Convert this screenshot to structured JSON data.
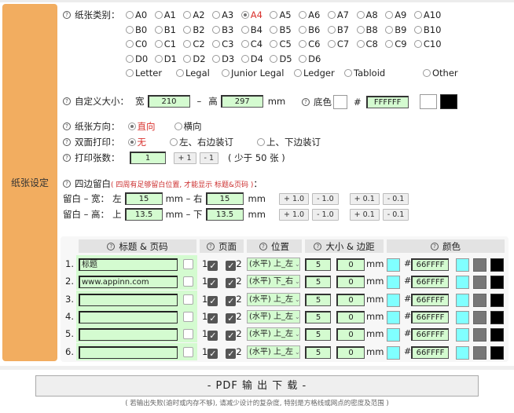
{
  "section": {
    "label": "纸张设定"
  },
  "paper_type": {
    "label": "纸张类别：",
    "selected": "A4",
    "rows": [
      [
        "A0",
        "A1",
        "A2",
        "A3",
        "A4",
        "A5",
        "A6",
        "A7",
        "A8",
        "A9",
        "A10"
      ],
      [
        "B0",
        "B1",
        "B2",
        "B3",
        "B4",
        "B5",
        "B6",
        "B7",
        "B8",
        "B9",
        "B10"
      ],
      [
        "C0",
        "C1",
        "C2",
        "C3",
        "C4",
        "C5",
        "C6",
        "C7",
        "C8",
        "C9",
        "C10"
      ],
      [
        "D0",
        "D1",
        "D2",
        "D3",
        "D4",
        "D5",
        "D6"
      ]
    ],
    "extra": [
      "Letter",
      "Legal",
      "Junior Legal",
      "Ledger",
      "Tabloid",
      "Other"
    ]
  },
  "custom_size": {
    "label": "自定义大小：",
    "width_label": "宽",
    "width": "210",
    "dash": "–",
    "height_label": "高",
    "height": "297",
    "unit": "mm"
  },
  "bg_color": {
    "label": "底色",
    "hash": "#",
    "value": "FFFFFF",
    "swatches": [
      "#FFFFFF",
      "#000000"
    ]
  },
  "orientation": {
    "label": "纸张方向：",
    "options": [
      "直向",
      "横向"
    ],
    "selected": "直向"
  },
  "duplex": {
    "label": "双面打印：",
    "options": [
      "无",
      "左、右边装订",
      "上、下边装订"
    ],
    "selected": "无"
  },
  "copies": {
    "label": "打印张数：",
    "value": "1",
    "plus": "+ 1",
    "minus": "- 1",
    "note": "( 少于 50 张 )"
  },
  "margins": {
    "label": "四边留白",
    "note": "( 四周有足够留白位置, 才能显示 标题&页码 )",
    "colon": "：",
    "width_row": {
      "label": "留白 – 宽：",
      "a_label": "左",
      "a": "15",
      "mid": "mm – 右",
      "b": "15",
      "unit": "mm"
    },
    "height_row": {
      "label": "留白 – 高：",
      "a_label": "上",
      "a": "13.5",
      "mid": "mm – 下",
      "b": "13.5",
      "unit": "mm"
    },
    "buttons": [
      "+ 1.0",
      "- 1.0",
      "+ 0.1",
      "- 0.1"
    ]
  },
  "header_table": {
    "columns": [
      "标题 & 页码",
      "页面",
      "位置",
      "大小 & 边距",
      "颜色"
    ],
    "rows": [
      {
        "num": "1.",
        "text": "标题",
        "page1": "1",
        "page2": "2",
        "position": "(水平) 上_左",
        "size": "5",
        "margin": "0",
        "unit": "mm",
        "hash": "#",
        "color": "66FFFF"
      },
      {
        "num": "2.",
        "text": "www.appinn.com",
        "page1": "1",
        "page2": "2",
        "position": "(水平) 下_右",
        "size": "5",
        "margin": "0",
        "unit": "mm",
        "hash": "#",
        "color": "66FFFF"
      },
      {
        "num": "3.",
        "text": "",
        "page1": "1",
        "page2": "2",
        "position": "(水平) 上_左",
        "size": "5",
        "margin": "0",
        "unit": "mm",
        "hash": "#",
        "color": "66FFFF"
      },
      {
        "num": "4.",
        "text": "",
        "page1": "1",
        "page2": "2",
        "position": "(水平) 上_左",
        "size": "5",
        "margin": "0",
        "unit": "mm",
        "hash": "#",
        "color": "66FFFF"
      },
      {
        "num": "5.",
        "text": "",
        "page1": "1",
        "page2": "2",
        "position": "(水平) 上_左",
        "size": "5",
        "margin": "0",
        "unit": "mm",
        "hash": "#",
        "color": "66FFFF"
      },
      {
        "num": "6.",
        "text": "",
        "page1": "1",
        "page2": "2",
        "position": "(水平) 上_左",
        "size": "5",
        "margin": "0",
        "unit": "mm",
        "hash": "#",
        "color": "66FFFF"
      }
    ],
    "preset_swatches": [
      "#80FFFF",
      "#777777",
      "#000000"
    ]
  },
  "pdf_button": "- PDF 输 出 下 载 -",
  "footnote": "( 若输出失败(逾时或内存不够), 请减少设计的复杂度, 特别是方格线或网点的密度及范围 )",
  "colors": {
    "sidebar": "#F2AD60",
    "input_bg": "#D4FBD0",
    "selected_text": "#D9322E",
    "swatch_cyan": "#80FFFF"
  }
}
